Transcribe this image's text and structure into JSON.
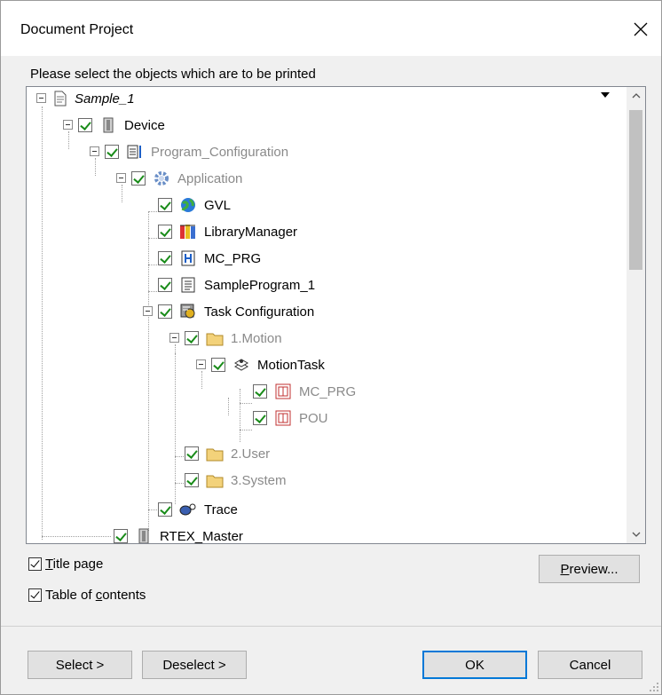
{
  "window": {
    "title": "Document Project"
  },
  "prompt": "Please select the objects which are to be printed",
  "tree": {
    "root": "Sample_1",
    "nodes": [
      {
        "label": "Device"
      },
      {
        "label": "Program_Configuration"
      },
      {
        "label": "Application"
      },
      {
        "label": "GVL"
      },
      {
        "label": "LibraryManager"
      },
      {
        "label": "MC_PRG"
      },
      {
        "label": "SampleProgram_1"
      },
      {
        "label": "Task Configuration"
      },
      {
        "label": "1.Motion"
      },
      {
        "label": "MotionTask"
      },
      {
        "label": "MC_PRG"
      },
      {
        "label": "POU"
      },
      {
        "label": "2.User"
      },
      {
        "label": "3.System"
      },
      {
        "label": "Trace"
      },
      {
        "label": "RTEX_Master"
      }
    ]
  },
  "options": {
    "title_page": "Title page",
    "title_page_key": "T",
    "title_page_rest": "itle page",
    "toc_pre": "Table of ",
    "toc_key": "c",
    "toc_rest": "ontents"
  },
  "buttons": {
    "preview_key": "P",
    "preview_rest": "review...",
    "select": "Select >",
    "deselect": "Deselect >",
    "ok": "OK",
    "cancel": "Cancel"
  },
  "colors": {
    "check": "#1a8c1a",
    "gray_text": "#8a8a8a",
    "accent": "#0078d7"
  }
}
